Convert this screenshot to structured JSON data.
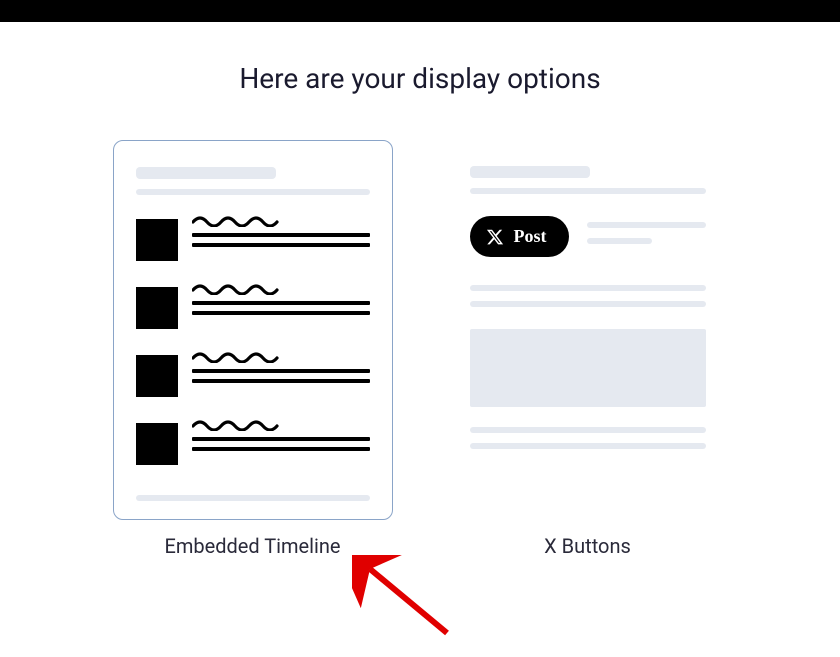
{
  "heading": "Here are your display options",
  "options": {
    "timeline": {
      "label": "Embedded Timeline"
    },
    "buttons": {
      "label": "X Buttons",
      "post_button": "Post"
    }
  }
}
